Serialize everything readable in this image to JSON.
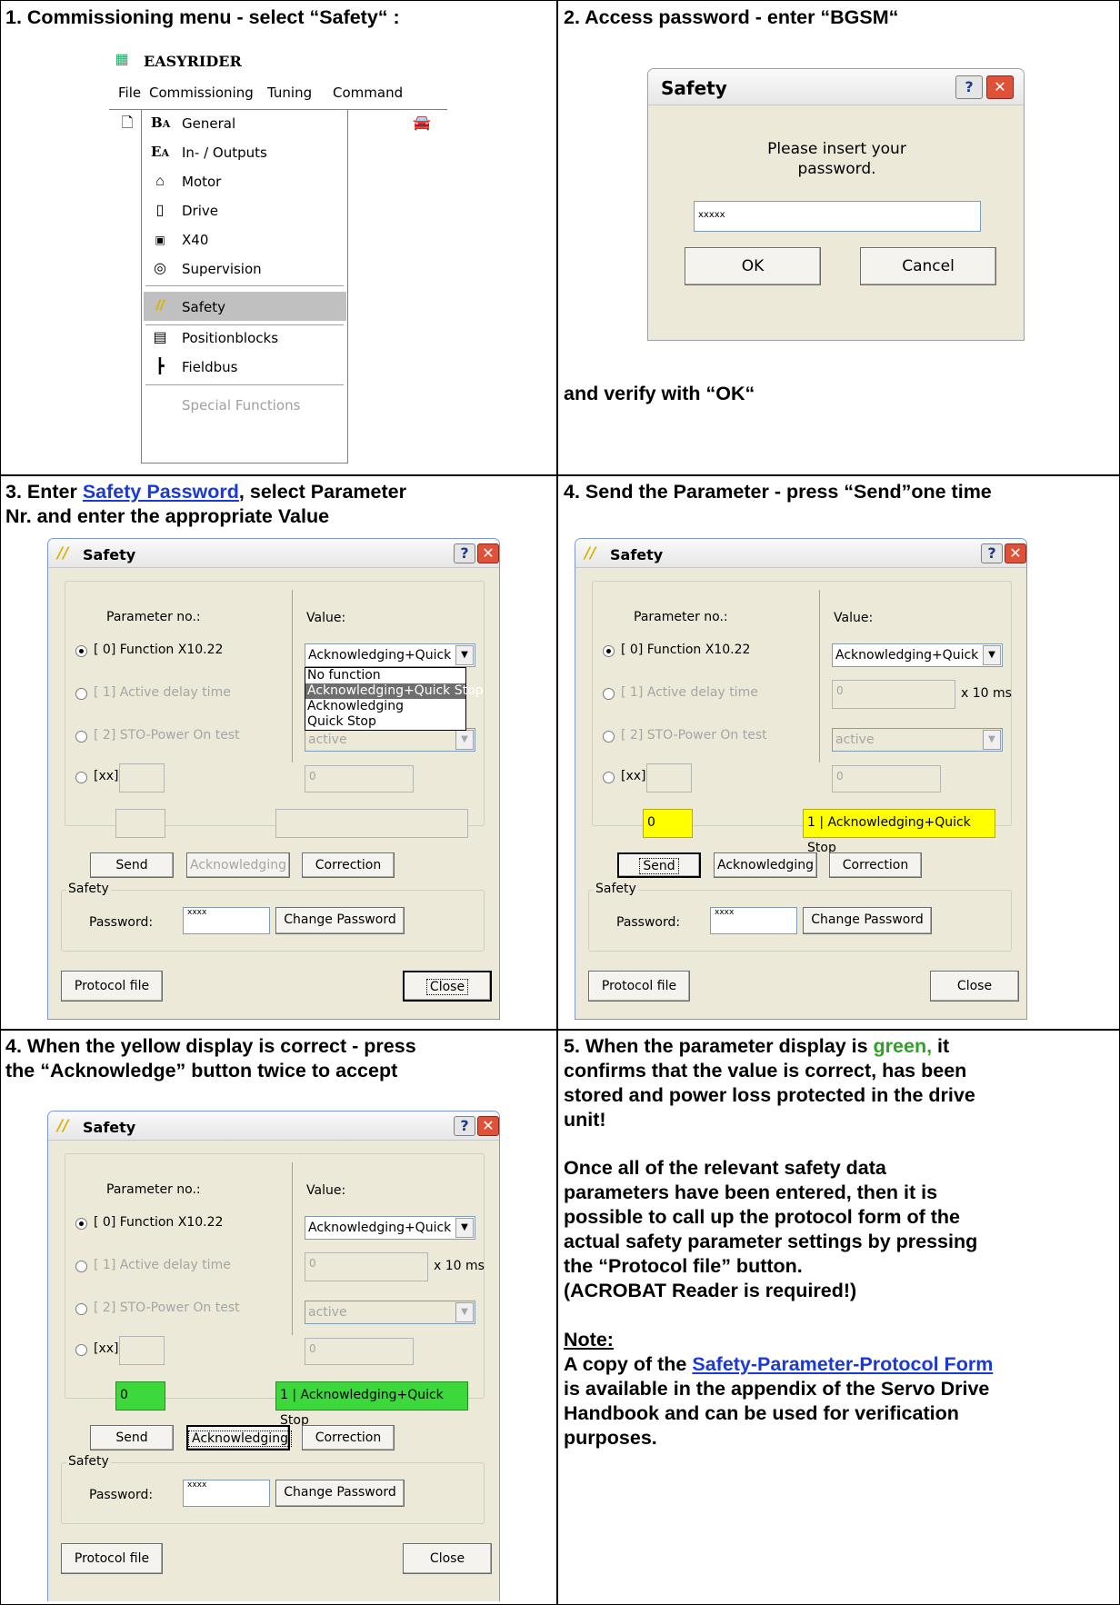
{
  "cells": {
    "c1": {
      "caption": "1. Commissioning menu - select “Safety“ :"
    },
    "c2": {
      "caption": "2. Access password - enter “BGSM“",
      "footer": "and verify with “OK“"
    },
    "c3": {
      "caption_pre": "3. Enter ",
      "caption_link": "Safety Password",
      "caption_post": ", select Parameter\nNr. and enter the appropriate Value"
    },
    "c4": {
      "caption": "4. Send the Parameter - press “Send”one time"
    },
    "c5": {
      "caption": "4. When  the yellow display is correct  - press\nthe “Acknowledge” button twice to accept"
    },
    "c6": {
      "caption_pre": "5. When the parameter display is ",
      "caption_green": "green,",
      "caption_post": " it\nconfirms that the value is correct, has been\nstored and power loss protected in the drive\nunit!",
      "body": "Once all of the relevant safety data\nparameters have been entered, then it is\npossible to call up the protocol form of the\nactual safety parameter settings by pressing\nthe “Protocol file” button.\n(ACROBAT Reader is required!)",
      "note_title": "Note:",
      "note_pre": "A copy of the ",
      "note_link": "Safety-Parameter-Protocol Form",
      "note_post": "\nis available in the appendix of the Servo Drive\nHandbook and can be used for verification\npurposes."
    }
  },
  "menu": {
    "app_title": "EASYRIDER",
    "menubar": [
      "File",
      "Commissioning",
      "Tuning",
      "Command"
    ],
    "items": [
      "General",
      "In- / Outputs",
      "Motor",
      "Drive",
      "X40",
      "Supervision",
      "Safety",
      "Positionblocks",
      "Fieldbus",
      "Special Functions"
    ]
  },
  "pwd_dialog": {
    "title": "Safety",
    "prompt": "Please insert your\npassword.",
    "value": "xxxxx",
    "ok": "OK",
    "cancel": "Cancel"
  },
  "safety_dialog": {
    "title": "Safety",
    "param_header": "Parameter no.:",
    "value_header": "Value:",
    "p0": "[ 0]  Function X10.22",
    "p1": "[ 1]  Active delay time",
    "p2": "[ 2]  STO-Power On test",
    "pxx": "[xx]",
    "p0_value": "Acknowledging+Quick",
    "p1_value": "0",
    "p1_unit": "x 10 ms",
    "p2_value": "active",
    "pxx_value": "0",
    "status_num": "0",
    "status_text": "1 | Acknowledging+Quick Stop",
    "send": "Send",
    "ack": "Acknowledging",
    "correction": "Correction",
    "group": "Safety",
    "password_label": "Password:",
    "password_value": "xxxx",
    "change_pw": "Change Password",
    "protocol": "Protocol file",
    "close": "Close",
    "dropdown": [
      "No function",
      "Acknowledging+Quick Stop",
      "Acknowledging",
      "Quick Stop"
    ]
  },
  "colors": {
    "yellow": "#ffff00",
    "green": "#3cd83c",
    "link": "#1a3ad8"
  }
}
